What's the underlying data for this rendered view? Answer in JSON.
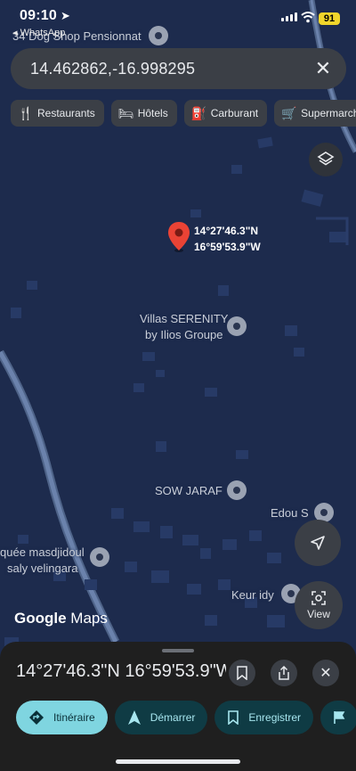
{
  "status_bar": {
    "time": "09:10",
    "back_app": "◂ WhatsApp",
    "battery": "91"
  },
  "search": {
    "value": "14.462862,-16.998295"
  },
  "chips": [
    {
      "icon": "restaurant-icon",
      "label": "Restaurants"
    },
    {
      "icon": "hotel-icon",
      "label": "Hôtels"
    },
    {
      "icon": "fuel-icon",
      "label": "Carburant"
    },
    {
      "icon": "cart-icon",
      "label": "Supermarché"
    }
  ],
  "map_labels": {
    "top_place": "34 Dog Shop Pensionnat",
    "villas_line1": "Villas SERENITY",
    "villas_line2": "by Ilios Groupe",
    "sow": "SOW JARAF",
    "edou": "Edou S",
    "mosque_line1": "quée masdjidoul",
    "mosque_line2": "saly velingara",
    "keur": "Keur idy"
  },
  "pin_label": {
    "lat": "14°27'46.3\"N",
    "lng": "16°59'53.9\"W"
  },
  "branding": {
    "google": "Google",
    "maps": "Maps"
  },
  "view_button": "View",
  "sheet": {
    "title": "14°27'46.3\"N 16°59'53.9\"W",
    "actions": [
      {
        "icon": "directions-icon",
        "label": "Itinéraire"
      },
      {
        "icon": "navigation-icon",
        "label": "Démarrer"
      },
      {
        "icon": "bookmark-icon",
        "label": "Enregistrer"
      },
      {
        "icon": "flag-icon",
        "label": ""
      }
    ]
  },
  "colors": {
    "map_bg": "#1d2b4d",
    "pin": "#ea4335",
    "accent": "#7fd5e0"
  }
}
